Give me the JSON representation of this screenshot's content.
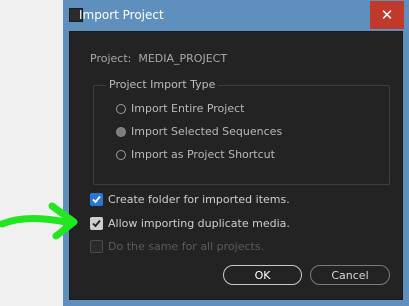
{
  "window": {
    "title": "Import Project",
    "close_glyph": "✕"
  },
  "project": {
    "label": "Project:",
    "name": "MEDIA_PROJECT"
  },
  "import_type": {
    "legend": "Project Import Type",
    "options": [
      {
        "label": "Import Entire Project",
        "selected": false
      },
      {
        "label": "Import Selected Sequences",
        "selected": true
      },
      {
        "label": "Import as Project Shortcut",
        "selected": false
      }
    ]
  },
  "options": {
    "create_folder": {
      "label": "Create folder for imported items.",
      "checked": true
    },
    "allow_duplicates": {
      "label": "Allow importing duplicate media.",
      "checked": true
    },
    "same_for_all": {
      "label": "Do the same for all projects.",
      "checked": false,
      "disabled": true
    }
  },
  "buttons": {
    "ok": "OK",
    "cancel": "Cancel"
  },
  "colors": {
    "title_bar": "#5f8fbd",
    "close_button": "#c0392b",
    "dialog_bg": "#232323",
    "checkbox_blue": "#2a75d6",
    "annotation_arrow": "#22e61f"
  },
  "icons": {
    "window": "app-icon",
    "close": "close-icon",
    "annotation": "green-arrow-icon"
  }
}
